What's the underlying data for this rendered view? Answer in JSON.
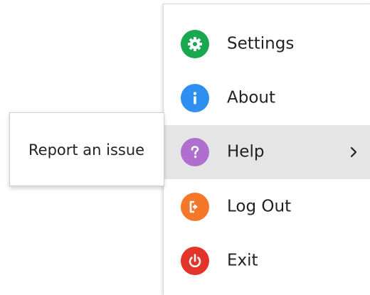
{
  "menu": {
    "items": [
      {
        "label": "Settings",
        "icon": "gear-icon",
        "color": "#1aa84f"
      },
      {
        "label": "About",
        "icon": "info-icon",
        "color": "#2f8ff0"
      },
      {
        "label": "Help",
        "icon": "question-icon",
        "color": "#b06fcf",
        "active": true,
        "has_submenu": true
      },
      {
        "label": "Log Out",
        "icon": "logout-icon",
        "color": "#f5782a"
      },
      {
        "label": "Exit",
        "icon": "power-icon",
        "color": "#e3342a"
      }
    ]
  },
  "submenu": {
    "items": [
      {
        "label": "Report an issue"
      }
    ]
  },
  "colors": {
    "active_row": "#e5e5e5",
    "text": "#222222"
  }
}
